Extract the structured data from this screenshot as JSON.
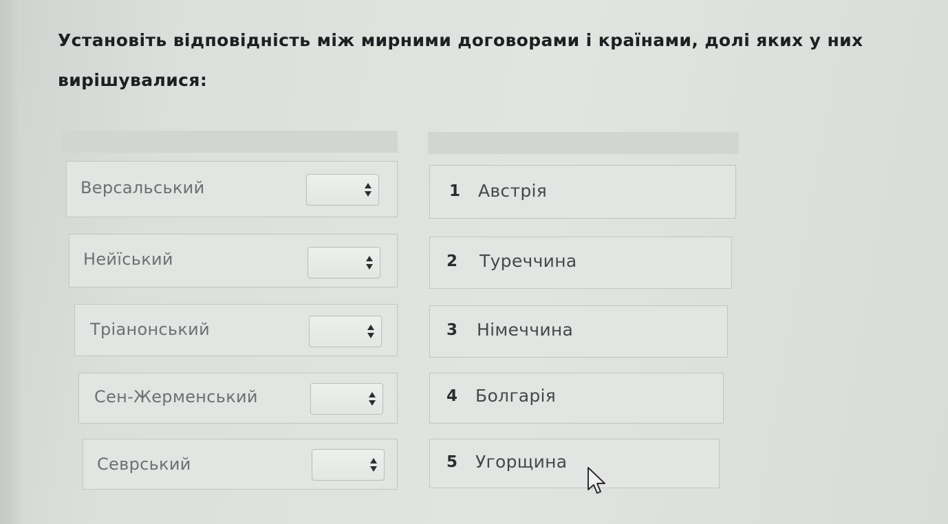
{
  "question": {
    "text": "Установіть відповідність між мирними договорами і країнами, долі яких у них  вирішувалися:"
  },
  "treaties": [
    {
      "label": "Версальський",
      "selected": ""
    },
    {
      "label": "Нейїський",
      "selected": ""
    },
    {
      "label": "Тріанонський",
      "selected": ""
    },
    {
      "label": "Сен-Жерменський",
      "selected": ""
    },
    {
      "label": "Севрський",
      "selected": ""
    }
  ],
  "countries": [
    {
      "num": "1",
      "label": "Австрія"
    },
    {
      "num": "2",
      "label": "Туреччина"
    },
    {
      "num": "3",
      "label": "Німеччина"
    },
    {
      "num": "4",
      "label": "Болгарія"
    },
    {
      "num": "5",
      "label": "Угорщина"
    }
  ],
  "icons": {
    "select_arrows": "up-down-arrows-icon",
    "cursor": "mouse-pointer-icon"
  },
  "colors": {
    "background": "#e2e4e1",
    "row_background": "#e3e5e2",
    "header_bar": "#d3d5d2",
    "question_text": "#1d1f22",
    "label_text": "#6d7073"
  }
}
